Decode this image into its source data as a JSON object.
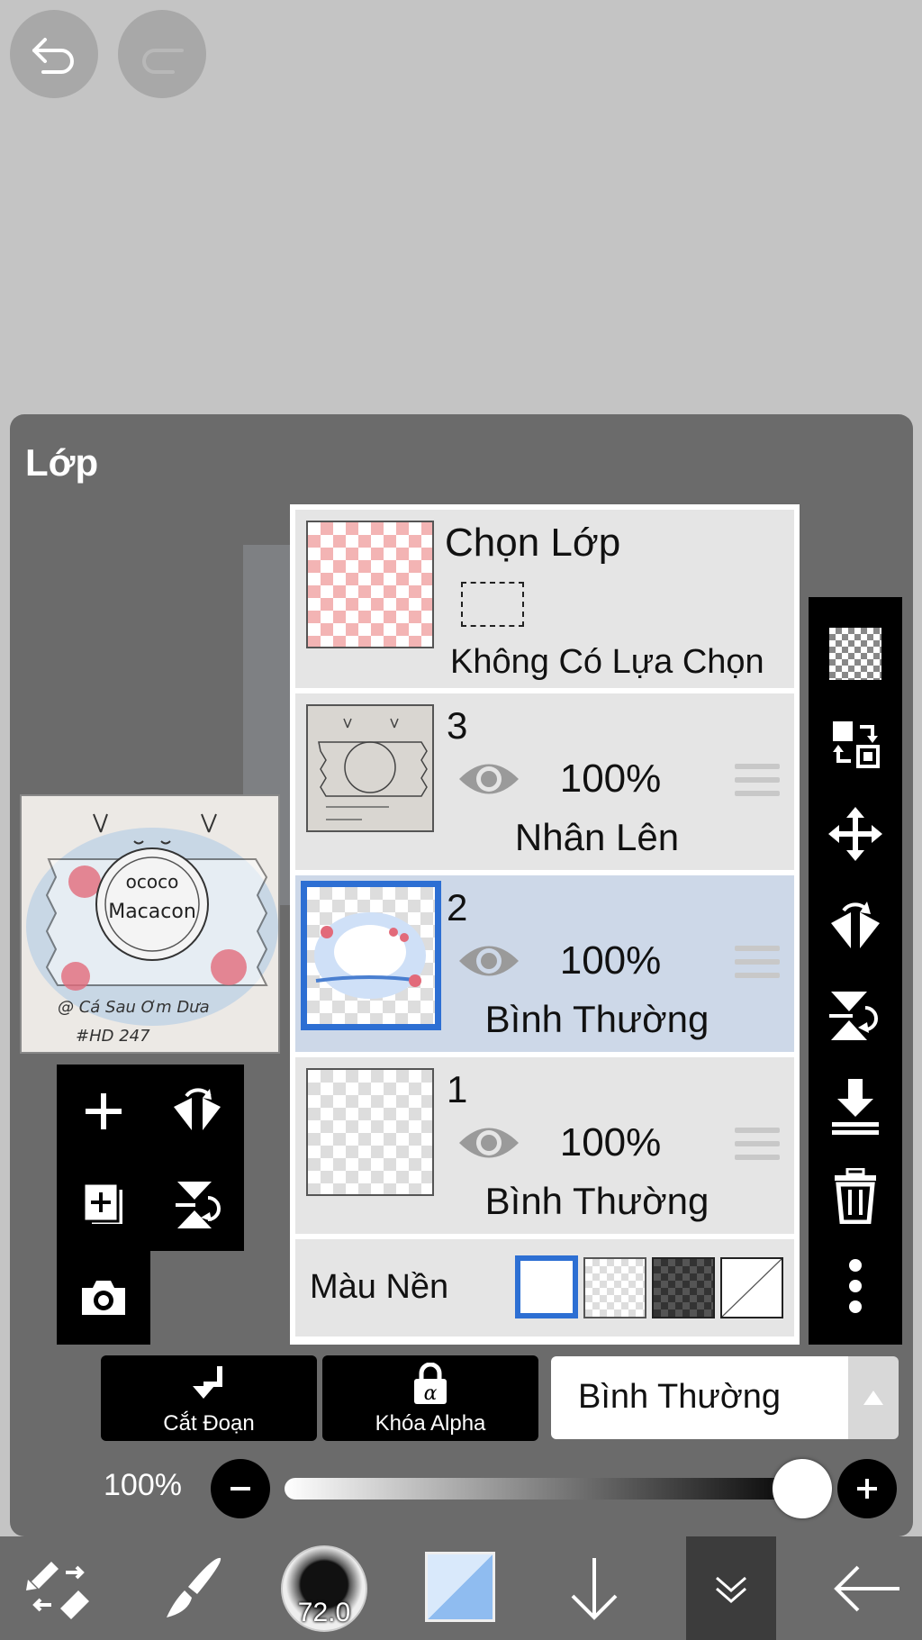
{
  "panel": {
    "title": "Lớp"
  },
  "selection_layer": {
    "title": "Chọn Lớp",
    "status": "Không Có Lựa Chọn"
  },
  "layers": [
    {
      "number": "3",
      "opacity": "100%",
      "blend": "Nhân Lên",
      "selected": false
    },
    {
      "number": "2",
      "opacity": "100%",
      "blend": "Bình Thường",
      "selected": true
    },
    {
      "number": "1",
      "opacity": "100%",
      "blend": "Bình Thường",
      "selected": false
    }
  ],
  "background": {
    "label": "Màu Nền",
    "options": [
      "white",
      "light-checker",
      "dark-checker",
      "none"
    ],
    "selected": "white"
  },
  "controls": {
    "clip_label": "Cắt Đoạn",
    "alpha_lock_label": "Khóa Alpha",
    "blend_mode": "Bình Thường",
    "opacity_label": "100%",
    "opacity_value": 1.0
  },
  "preview_text": {
    "line1": "ococo",
    "line2": "Macacon",
    "line3": "@ Cá Sau Ơm Dưa",
    "line4": "#HD 247"
  },
  "bottom_bar": {
    "brush_size": "72.0",
    "color_primary": "#8fbcf0",
    "color_secondary": "#d9e9fb"
  },
  "icons": {
    "top": [
      "undo-icon",
      "redo-icon"
    ],
    "left_tools": [
      "add-layer-icon",
      "flip-horizontal-icon",
      "duplicate-layer-icon",
      "flip-vertical-icon",
      "camera-icon"
    ],
    "right_tools": [
      "checker-icon",
      "swap-layer-icon",
      "move-icon",
      "flip-h-icon",
      "flip-v-icon",
      "merge-down-icon",
      "trash-icon",
      "more-icon"
    ],
    "bottom": [
      "transform-tool-icon",
      "brush-icon",
      "brush-size-icon",
      "color-icon",
      "arrow-down-icon",
      "collapse-icon",
      "back-icon"
    ]
  }
}
